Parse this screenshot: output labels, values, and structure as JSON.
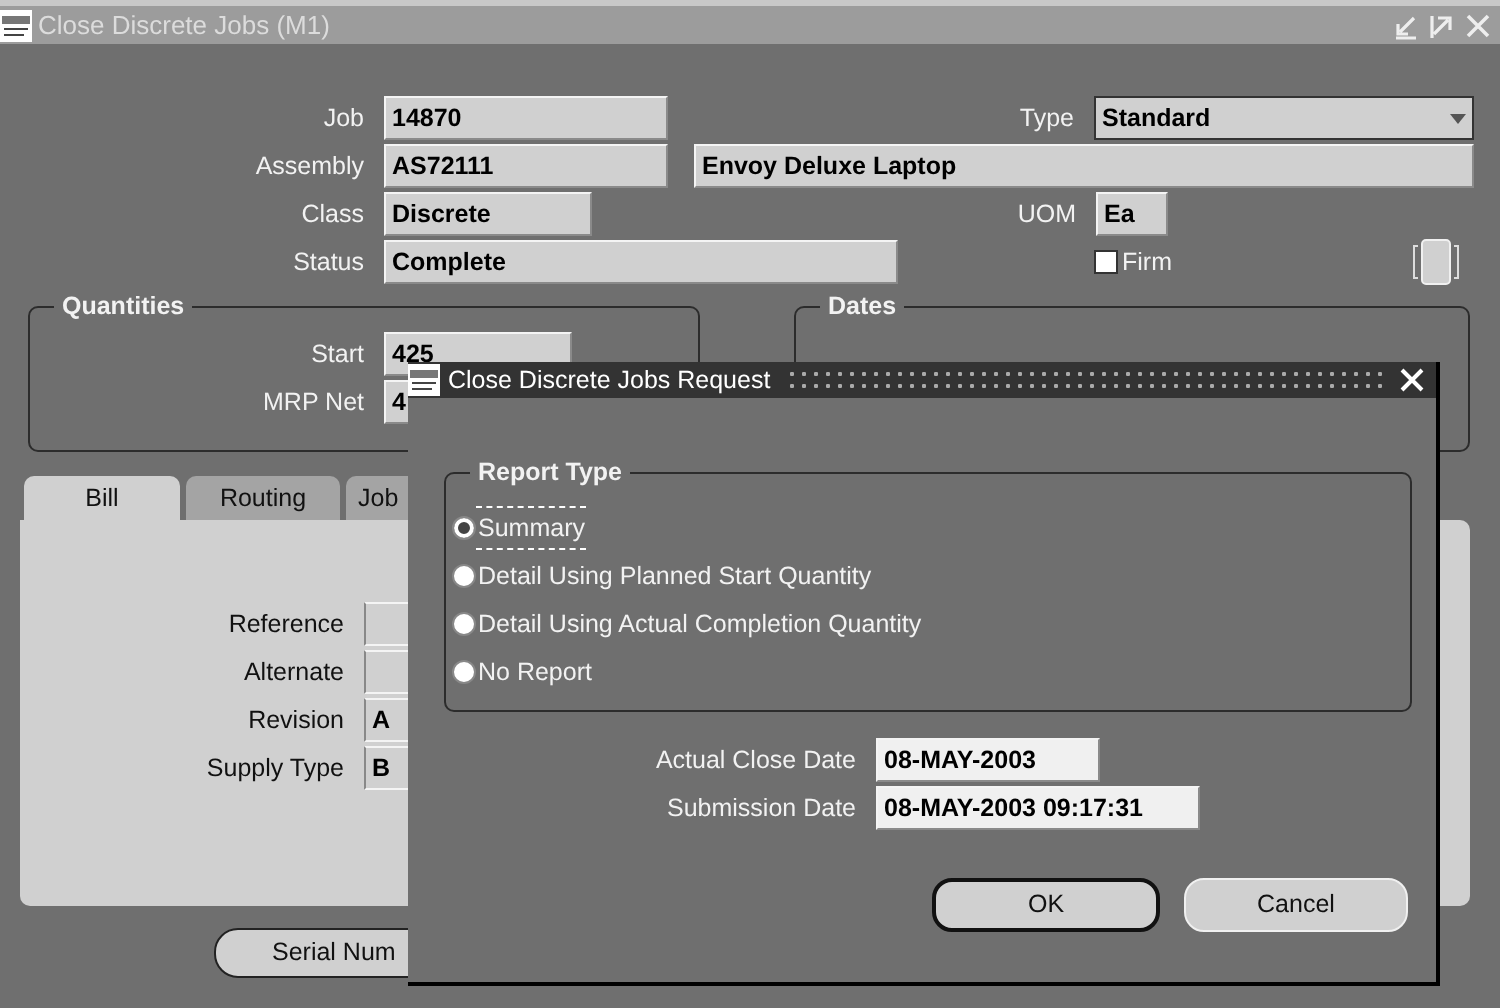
{
  "window": {
    "title": "Close Discrete Jobs (M1)"
  },
  "job": {
    "label": "Job",
    "value": "14870"
  },
  "type": {
    "label": "Type",
    "value": "Standard"
  },
  "assembly": {
    "label": "Assembly",
    "value": "AS72111",
    "description": "Envoy Deluxe Laptop"
  },
  "class": {
    "label": "Class",
    "value": "Discrete"
  },
  "uom": {
    "label": "UOM",
    "value": "Ea"
  },
  "status": {
    "label": "Status",
    "value": "Complete"
  },
  "firm": {
    "label": "Firm",
    "checked": false
  },
  "quantities": {
    "title": "Quantities",
    "fields": [
      {
        "label": "Start",
        "value": "425"
      },
      {
        "label": "MRP Net",
        "value": "4"
      }
    ]
  },
  "dates": {
    "title": "Dates"
  },
  "tabs": [
    {
      "label": "Bill",
      "selected": true
    },
    {
      "label": "Routing",
      "selected": false
    },
    {
      "label": "Job",
      "selected": false
    }
  ],
  "bill_fields": [
    {
      "label": "Reference"
    },
    {
      "label": "Alternate"
    },
    {
      "label": "Revision",
      "value": "A"
    },
    {
      "label": "Supply Type",
      "value": "B"
    }
  ],
  "serial_button": {
    "label": "Serial Num"
  },
  "dialog": {
    "title": "Close Discrete Jobs Request",
    "report_type": {
      "title": "Report Type",
      "options": [
        {
          "label": "Summary",
          "selected": true
        },
        {
          "label": "Detail Using Planned Start Quantity",
          "selected": false
        },
        {
          "label": "Detail Using Actual Completion Quantity",
          "selected": false
        },
        {
          "label": "No Report",
          "selected": false
        }
      ]
    },
    "fields": [
      {
        "label": "Actual Close Date",
        "value": "08-MAY-2003"
      },
      {
        "label": "Submission Date",
        "value": "08-MAY-2003 09:17:31"
      }
    ],
    "buttons": [
      {
        "label": "OK",
        "default": true
      },
      {
        "label": "Cancel",
        "default": false
      }
    ]
  }
}
